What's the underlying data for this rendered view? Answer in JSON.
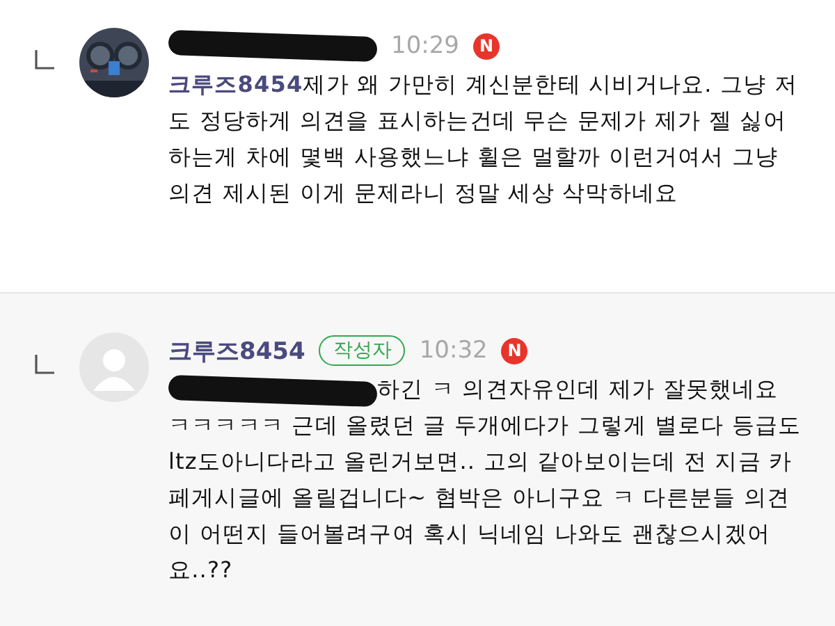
{
  "comments": [
    {
      "highlighted": false,
      "author": {
        "redacted": true
      },
      "time": "10:29",
      "new_badge": "N",
      "mention": {
        "text": "크루즈8454",
        "redacted": false
      },
      "body": "제가 왜 가만히 계신분한테 시비거나요. 그냥 저도 정당하게 의견을 표시하는건데 무슨 문제가 제가 젤 싫어하는게 차에 몇백 사용했느냐 휠은 멀할까 이런거여서 그냥 의견 제시된 이게 문제라니 정말 세상 삭막하네요"
    },
    {
      "highlighted": true,
      "avatar": {
        "kind": "default"
      },
      "author": {
        "redacted": false,
        "name": "크루즈8454",
        "badge": "작성자"
      },
      "time": "10:32",
      "new_badge": "N",
      "mention": {
        "redacted": true
      },
      "body": "하긴 ㅋ 의견자유인데 제가 잘못했네요 ㅋㅋㅋㅋㅋ 근데 올렸던 글 두개에다가 그렇게 별로다 등급도 ltz도아니다라고 올린거보면.. 고의 같아보이는데 전 지금 카페게시글에 올릴겁니다~ 협박은 아니구요 ㅋ 다른분들 의견이 어떤지 들어볼려구여 혹시 닉네임 나와도 괜찮으시겠어요..??"
    }
  ]
}
